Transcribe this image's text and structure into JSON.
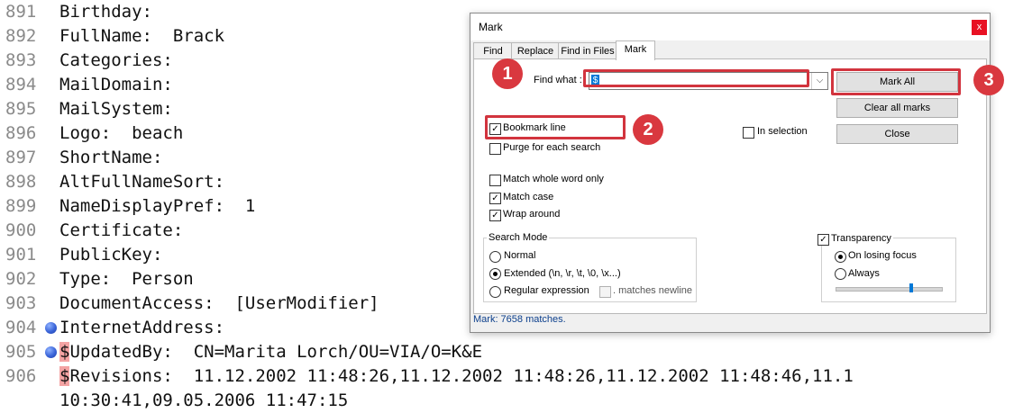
{
  "editor": {
    "lines": [
      {
        "num": "891",
        "mark": "",
        "text": "Birthday:"
      },
      {
        "num": "892",
        "mark": "",
        "text": "FullName:  Brack"
      },
      {
        "num": "893",
        "mark": "",
        "text": "Categories:"
      },
      {
        "num": "894",
        "mark": "",
        "text": "MailDomain:"
      },
      {
        "num": "895",
        "mark": "",
        "text": "MailSystem:"
      },
      {
        "num": "896",
        "mark": "",
        "text": "Logo:  beach"
      },
      {
        "num": "897",
        "mark": "",
        "text": "ShortName:"
      },
      {
        "num": "898",
        "mark": "",
        "text": "AltFullNameSort:"
      },
      {
        "num": "899",
        "mark": "",
        "text": "NameDisplayPref:  1"
      },
      {
        "num": "900",
        "mark": "",
        "text": "Certificate:"
      },
      {
        "num": "901",
        "mark": "",
        "text": "PublicKey:"
      },
      {
        "num": "902",
        "mark": "",
        "text": "Type:  Person"
      },
      {
        "num": "903",
        "mark": "",
        "text": "DocumentAccess:  [UserModifier]"
      },
      {
        "num": "904",
        "mark": "",
        "text": "InternetAddress:"
      },
      {
        "num": "905",
        "mark": "$",
        "text": "UpdatedBy:  CN=Marita Lorch/OU=VIA/O=K&E"
      },
      {
        "num": "906",
        "mark": "$",
        "text": "Revisions:  11.12.2002 11:48:26,11.12.2002 11:48:26,11.12.2002 11:48:46,11.1"
      },
      {
        "num": "",
        "mark": "",
        "text": "10:30:41,09.05.2006 11:47:15"
      }
    ]
  },
  "dialog": {
    "title": "Mark",
    "close_glyph": "x",
    "tabs": [
      "Find",
      "Replace",
      "Find in Files",
      "Mark"
    ],
    "find_what_label": "Find what :",
    "find_what_value": "$",
    "buttons": {
      "mark_all": "Mark All",
      "clear_all_marks": "Clear all marks",
      "close": "Close"
    },
    "options": {
      "bookmark_line": {
        "label": "Bookmark line",
        "checked": true
      },
      "purge": {
        "label": "Purge for each search",
        "checked": false
      },
      "in_selection": {
        "label": "In selection",
        "checked": false
      },
      "match_whole_word": {
        "label": "Match whole word only",
        "checked": false
      },
      "match_case": {
        "label": "Match case",
        "checked": true
      },
      "wrap_around": {
        "label": "Wrap around",
        "checked": true
      }
    },
    "search_mode": {
      "title": "Search Mode",
      "normal": "Normal",
      "extended": "Extended (\\n, \\r, \\t, \\0, \\x...)",
      "regex": "Regular expression",
      "matches_newline": ". matches newline",
      "selected": "extended"
    },
    "transparency": {
      "label": "Transparency",
      "checked": true,
      "on_losing_focus": "On losing focus",
      "always": "Always",
      "selected": "on_losing_focus",
      "level": 0.72
    },
    "status": "Mark: 7658 matches."
  },
  "annotations": [
    "1",
    "2",
    "3"
  ],
  "colors": {
    "annotation": "#d2343e",
    "mark_highlight": "#f4a3a3",
    "bookmark": "#3a64d8",
    "status": "#0c3f8c"
  }
}
